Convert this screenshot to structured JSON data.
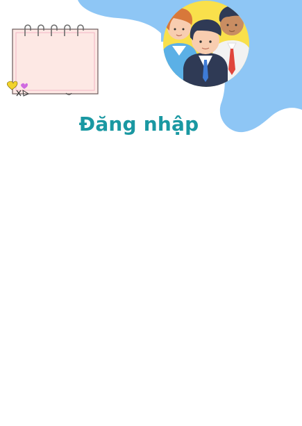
{
  "header": {
    "title": "Đăng nhập"
  },
  "decor": {
    "notepad_icon": "notepad-icon",
    "people_icon": "team-people-icon",
    "blob_color": "#8ec6f5",
    "circle_color": "#f9e04b"
  },
  "colors": {
    "title": "#1a98a2",
    "background": "#ffffff"
  }
}
